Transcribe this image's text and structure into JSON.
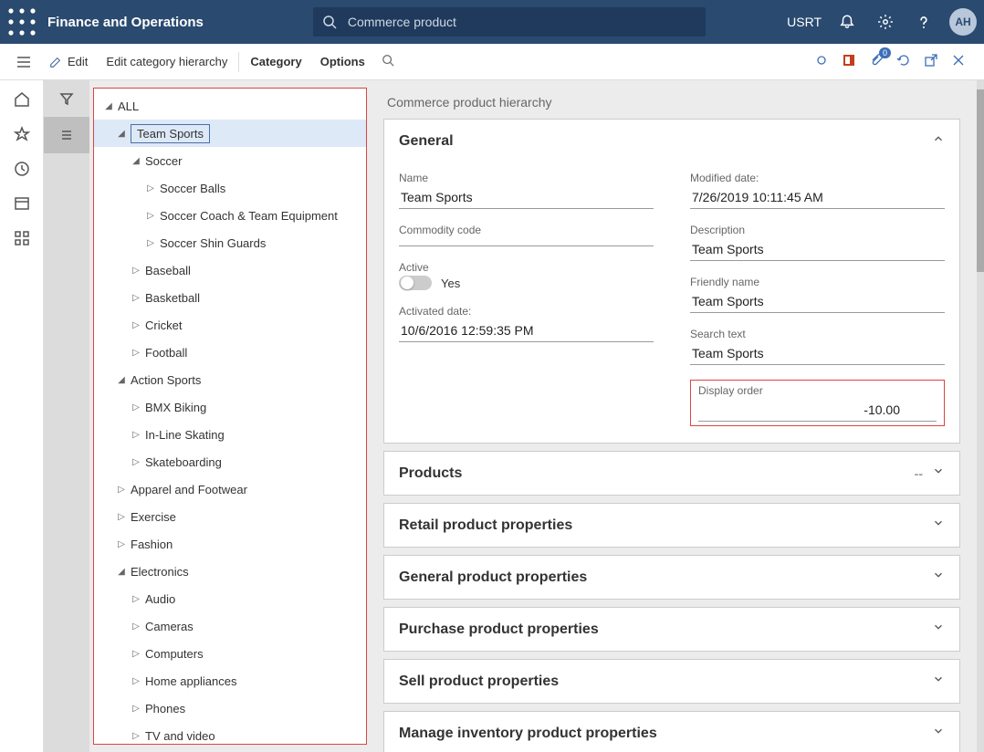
{
  "header": {
    "app_title": "Finance and Operations",
    "search_text": "Commerce product",
    "company": "USRT",
    "avatar": "AH"
  },
  "actionbar": {
    "edit": "Edit",
    "edit_hierarchy": "Edit category hierarchy",
    "category": "Category",
    "options": "Options",
    "badge_count": "0"
  },
  "page": {
    "title": "Commerce product hierarchy"
  },
  "tree": [
    {
      "level": 0,
      "exp": "down",
      "label": "ALL"
    },
    {
      "level": 1,
      "exp": "down",
      "label": "Team Sports",
      "selected": true
    },
    {
      "level": 2,
      "exp": "down",
      "label": "Soccer"
    },
    {
      "level": 3,
      "exp": "right",
      "label": "Soccer Balls"
    },
    {
      "level": 3,
      "exp": "right",
      "label": "Soccer Coach & Team Equipment"
    },
    {
      "level": 3,
      "exp": "right",
      "label": "Soccer Shin Guards"
    },
    {
      "level": 2,
      "exp": "right",
      "label": "Baseball"
    },
    {
      "level": 2,
      "exp": "right",
      "label": "Basketball"
    },
    {
      "level": 2,
      "exp": "right",
      "label": "Cricket"
    },
    {
      "level": 2,
      "exp": "right",
      "label": "Football"
    },
    {
      "level": 1,
      "exp": "down",
      "label": "Action Sports"
    },
    {
      "level": 2,
      "exp": "right",
      "label": "BMX Biking"
    },
    {
      "level": 2,
      "exp": "right",
      "label": "In-Line Skating"
    },
    {
      "level": 2,
      "exp": "right",
      "label": "Skateboarding"
    },
    {
      "level": 1,
      "exp": "right",
      "label": "Apparel and Footwear"
    },
    {
      "level": 1,
      "exp": "right",
      "label": "Exercise"
    },
    {
      "level": 1,
      "exp": "right",
      "label": "Fashion"
    },
    {
      "level": 1,
      "exp": "down",
      "label": "Electronics"
    },
    {
      "level": 2,
      "exp": "right",
      "label": "Audio"
    },
    {
      "level": 2,
      "exp": "right",
      "label": "Cameras"
    },
    {
      "level": 2,
      "exp": "right",
      "label": "Computers"
    },
    {
      "level": 2,
      "exp": "right",
      "label": "Home appliances"
    },
    {
      "level": 2,
      "exp": "right",
      "label": "Phones"
    },
    {
      "level": 2,
      "exp": "right",
      "label": "TV and video"
    }
  ],
  "general": {
    "title": "General",
    "name_label": "Name",
    "name_value": "Team Sports",
    "commodity_label": "Commodity code",
    "commodity_value": "",
    "active_label": "Active",
    "active_value": "Yes",
    "activated_label": "Activated date:",
    "activated_value": "10/6/2016 12:59:35 PM",
    "modified_label": "Modified date:",
    "modified_value": "7/26/2019 10:11:45 AM",
    "description_label": "Description",
    "description_value": "Team Sports",
    "friendly_label": "Friendly name",
    "friendly_value": "Team Sports",
    "searchtext_label": "Search text",
    "searchtext_value": "Team Sports",
    "display_order_label": "Display order",
    "display_order_value": "-10.00"
  },
  "sections": {
    "products": "Products",
    "products_dashes": "--",
    "retail": "Retail product properties",
    "general_pp": "General product properties",
    "purchase": "Purchase product properties",
    "sell": "Sell product properties",
    "manage_inv": "Manage inventory product properties"
  }
}
